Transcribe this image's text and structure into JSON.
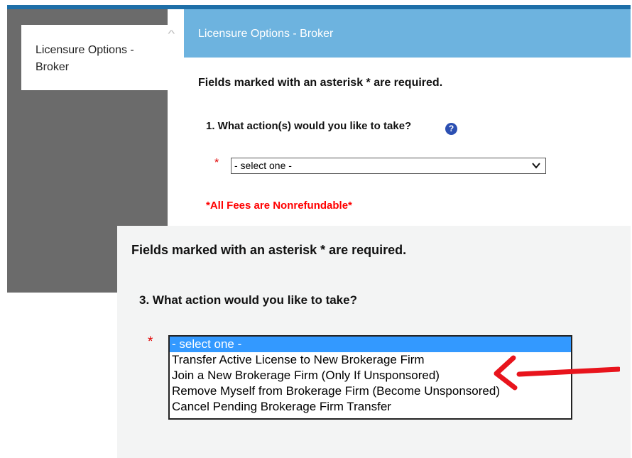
{
  "shot1": {
    "sidebar": {
      "items": [
        {
          "label": "Licensure Options - Broker"
        }
      ]
    },
    "header": {
      "title": "Licensure Options - Broker"
    },
    "required_note": "Fields marked with an asterisk * are required.",
    "question": "1. What action(s) would you like to take?",
    "help_icon": "?",
    "required_star": "*",
    "select": {
      "value": "- select one -"
    },
    "fees_note": "*All Fees are Nonrefundable*"
  },
  "shot2": {
    "required_note": "Fields marked with an asterisk * are required.",
    "question": "3. What action would you like to take?",
    "required_star": "*",
    "listbox": {
      "options": [
        "- select one -",
        "Transfer Active License to New Brokerage Firm",
        "Join a New Brokerage Firm (Only If Unsponsored)",
        "Remove Myself from Brokerage Firm (Become Unsponsored)",
        "Cancel Pending Brokerage Firm Transfer"
      ],
      "selected_index": 0
    }
  },
  "annotation": {
    "arrow_color": "#e8141c",
    "points_to": "Join a New Brokerage Firm (Only If Unsponsored)"
  },
  "colors": {
    "header": "#6db3df",
    "top_rule": "#1e6fa8",
    "sidebar_bg": "#6b6b6b",
    "required": "#e00000",
    "selection": "#3399ff"
  }
}
